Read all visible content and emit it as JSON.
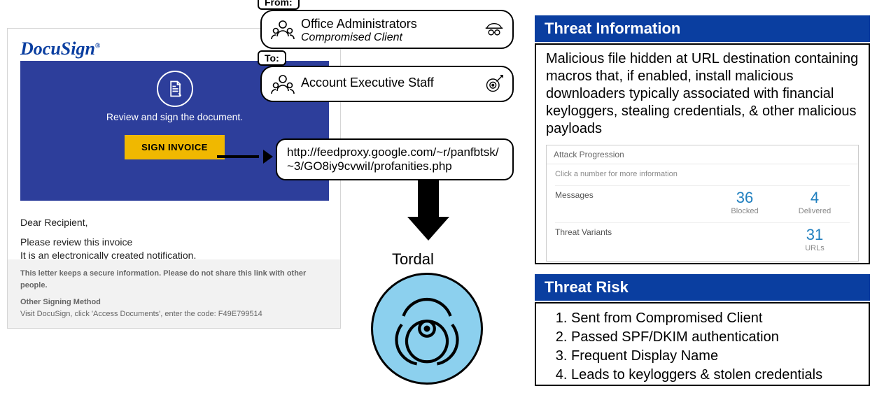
{
  "email": {
    "logo": "DocuSign",
    "hero_text": "Review and sign the document.",
    "button": "SIGN INVOICE",
    "greeting": "Dear Recipient,",
    "line1": "Please review this invoice",
    "line2": "It is an electronically created notification.",
    "footer1": "This letter keeps a secure information. Please do not share this link with other people.",
    "footer2a": "Other Signing Method",
    "footer2b": "Visit DocuSign, click 'Access Documents', enter the code: F49E799514"
  },
  "from": {
    "tag": "From:",
    "title": "Office Administrators",
    "subtitle": "Compromised Client"
  },
  "to": {
    "tag": "To:",
    "title": "Account Executive Staff"
  },
  "url": "http://feedproxy.google.com/~r/panfbtsk/~3/GO8iy9cvwiI/profanities.php",
  "malware": "Tordal",
  "threat_info": {
    "header": "Threat Information",
    "description": "Malicious file hidden at URL destination containing macros that, if enabled, install malicious downloaders typically associated with financial keyloggers, stealing credentials, & other malicious payloads",
    "box_title": "Attack Progression",
    "box_help": "Click a number for more information",
    "row1_label": "Messages",
    "row1_a_num": "36",
    "row1_a_cap": "Blocked",
    "row1_b_num": "4",
    "row1_b_cap": "Delivered",
    "row2_label": "Threat Variants",
    "row2_a_num": "31",
    "row2_a_cap": "URLs"
  },
  "threat_risk": {
    "header": "Threat Risk",
    "items": [
      "Sent from Compromised Client",
      "Passed SPF/DKIM authentication",
      "Frequent Display Name",
      "Leads to keyloggers & stolen credentials"
    ]
  }
}
